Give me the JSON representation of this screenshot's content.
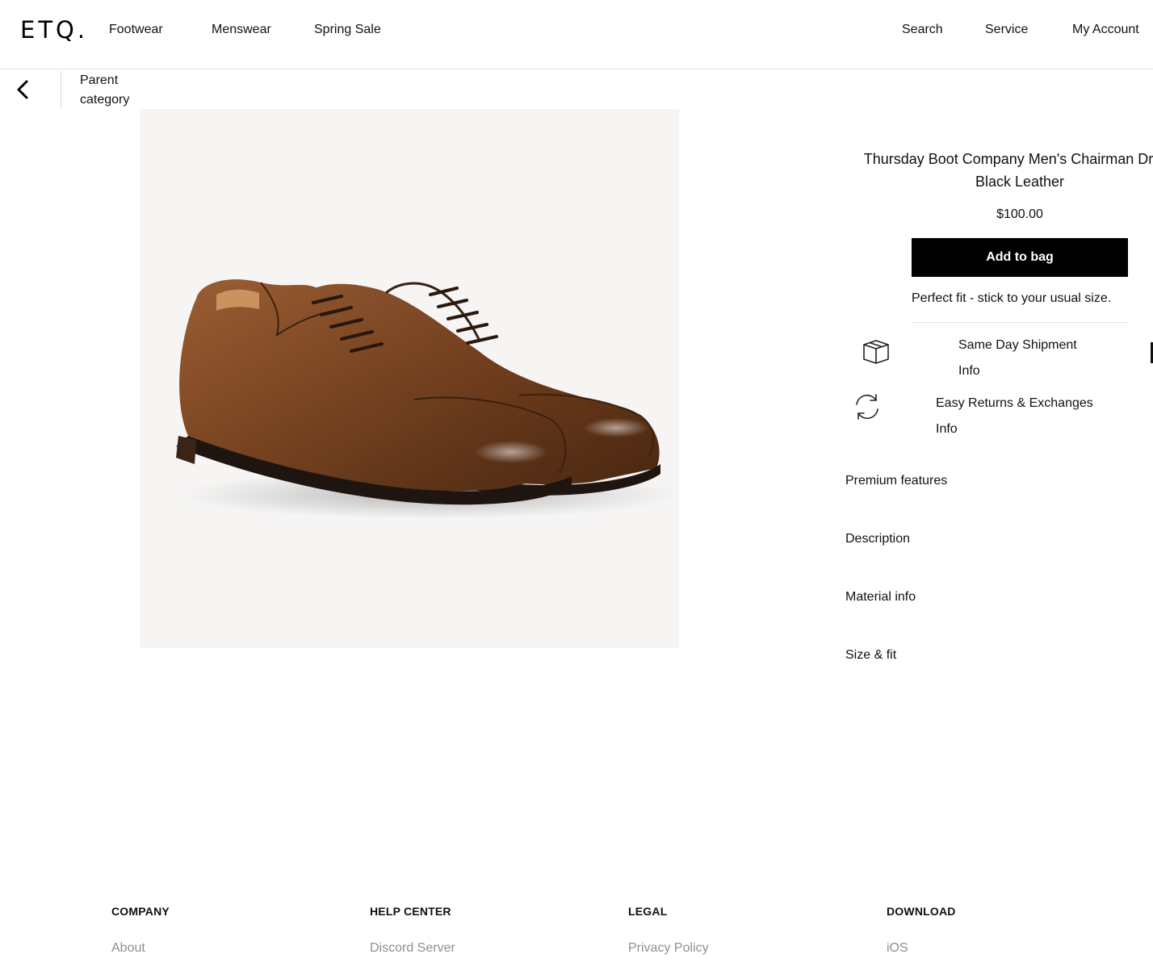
{
  "header": {
    "logo": "ETQ.",
    "nav_left": [
      "Footwear",
      "Menswear",
      "Spring Sale"
    ],
    "nav_right": [
      "Search",
      "Service",
      "My Account"
    ]
  },
  "breadcrumb": {
    "back_icon": "chevron-left-icon",
    "parent_line1": "Parent",
    "parent_line2": "category"
  },
  "product": {
    "title_line1": "Thursday Boot Company Men's Chairman Dress",
    "title_line2": "Black Leather",
    "price": "$100.00",
    "add_to_bag": "Add to bag",
    "fit_note": "Perfect fit - stick to your usual size.",
    "benefits": [
      {
        "icon": "box-icon",
        "title": "Same Day Shipment",
        "link": "Info"
      },
      {
        "icon": "refresh-icon",
        "title": "Easy Returns & Exchanges",
        "link": "Info"
      }
    ],
    "accordion": [
      "Premium features",
      "Description",
      "Material info",
      "Size & fit"
    ]
  },
  "footer": {
    "columns": [
      {
        "heading": "COMPANY",
        "first_link": "About"
      },
      {
        "heading": "HELP CENTER",
        "first_link": "Discord Server"
      },
      {
        "heading": "LEGAL",
        "first_link": "Privacy Policy"
      },
      {
        "heading": "DOWNLOAD",
        "first_link": "iOS"
      }
    ]
  },
  "colors": {
    "primary_button": "#000000",
    "image_background": "#f6f5f4",
    "footer_link": "#8a8f98"
  }
}
